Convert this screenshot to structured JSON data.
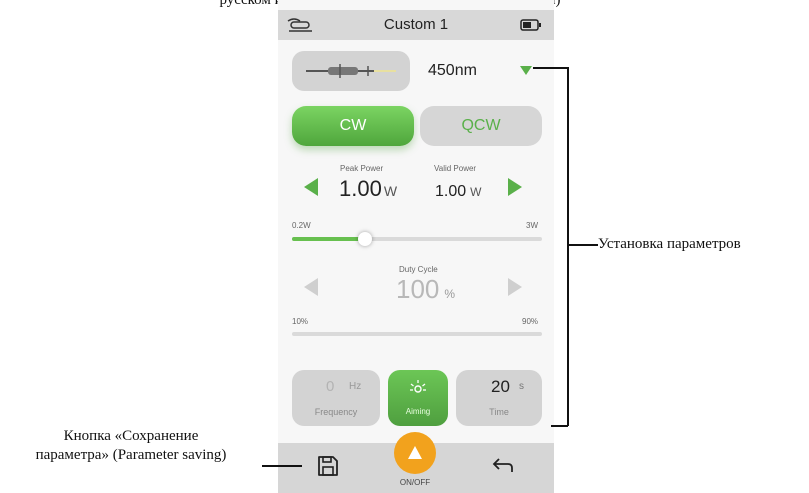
{
  "caption_top": "русском и английском языках (а также уникальными)",
  "device": {
    "title": "Custom 1",
    "wavelength": "450nm",
    "modes": {
      "cw": "CW",
      "qcw": "QCW"
    },
    "power": {
      "peak_label": "Peak Power",
      "peak_value": "1.00",
      "peak_unit": "W",
      "valid_label": "Valid Power",
      "valid_value": "1.00",
      "valid_unit": "W",
      "min_label": "0.2W",
      "max_label": "3W",
      "level": 0.29
    },
    "duty": {
      "label": "Duty Cycle",
      "value": "100",
      "unit": "%",
      "min_label": "10%",
      "max_label": "90%"
    },
    "frequency": {
      "value": "0",
      "unit": "Hz",
      "label": "Frequency"
    },
    "aiming": {
      "label": "Aiming"
    },
    "time": {
      "value": "20",
      "unit": "s",
      "label": "Time"
    },
    "onoff_label": "ON/OFF"
  },
  "callouts": {
    "right": "Установка параметров",
    "left_line1": "Кнопка «Сохранение",
    "left_line2": "параметра» (Parameter saving)"
  },
  "colors": {
    "accent_green": "#5ab04a",
    "onoff_orange": "#f2a21d"
  },
  "icons": [
    "fiber-handpiece-icon",
    "battery-icon",
    "save-icon",
    "undo-arrow-icon",
    "sun-icon",
    "triangle-up-icon"
  ]
}
